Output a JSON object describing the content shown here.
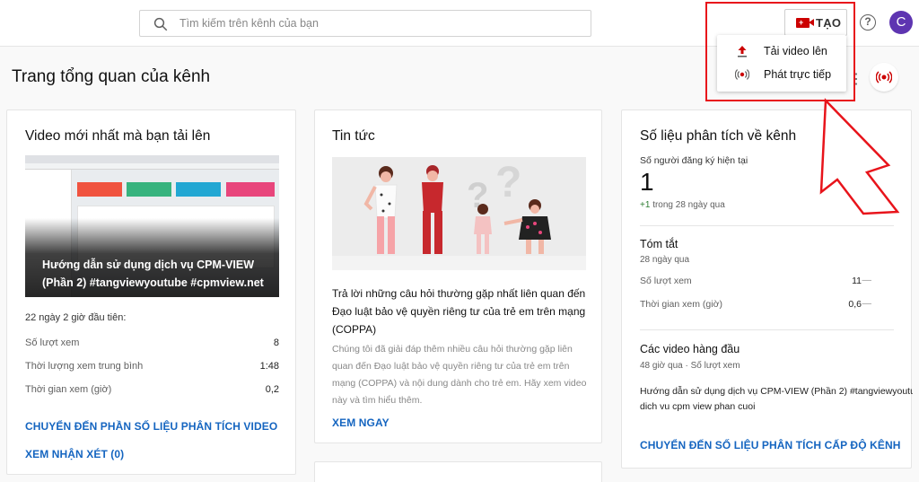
{
  "search": {
    "placeholder": "Tìm kiếm trên kênh của bạn"
  },
  "header": {
    "create_label": "TẠO",
    "help_icon": "help-icon",
    "avatar_letter": "C"
  },
  "create_menu": {
    "items": [
      {
        "label": "Tải video lên",
        "icon": "upload-icon"
      },
      {
        "label": "Phát trực tiếp",
        "icon": "live-icon"
      }
    ]
  },
  "page": {
    "title": "Trang tổng quan của kênh"
  },
  "latest_video": {
    "heading": "Video mới nhất mà bạn tải lên",
    "video_title": "Hướng dẫn sử dụng dịch vụ CPM-VIEW (Phần 2) #tangviewyoutube #cpmview.net",
    "period": "22 ngày 2 giờ đầu tiên:",
    "stats": [
      {
        "label": "Số lượt xem",
        "value": "8"
      },
      {
        "label": "Thời lượng xem trung bình",
        "value": "1:48"
      },
      {
        "label": "Thời gian xem (giờ)",
        "value": "0,2"
      }
    ],
    "analytics_link": "CHUYỂN ĐẾN PHẦN SỐ LIỆU PHÂN TÍCH VIDEO",
    "comments_link": "XEM NHẬN XÉT (0)"
  },
  "news": {
    "heading": "Tin tức",
    "title": "Trả lời những câu hỏi thường gặp nhất liên quan đến Đạo luật bảo vệ quyền riêng tư của trẻ em trên mạng (COPPA)",
    "body": "Chúng tôi đã giải đáp thêm nhiều câu hỏi thường gặp liên quan đến Đạo luật bảo vệ quyền riêng tư của trẻ em trên mạng (COPPA) và nội dung dành cho trẻ em. Hãy xem video này và tìm hiểu thêm.",
    "cta": "XEM NGAY"
  },
  "analytics": {
    "heading": "Số liệu phân tích về kênh",
    "subs_label": "Số người đăng ký hiện tại",
    "subs_value": "1",
    "subs_change": "+1",
    "subs_change_period": "trong 28 ngày qua",
    "summary_heading": "Tóm tắt",
    "summary_period": "28 ngày qua",
    "summary": [
      {
        "label": "Số lượt xem",
        "value": "11"
      },
      {
        "label": "Thời gian xem (giờ)",
        "value": "0,6"
      }
    ],
    "top_videos_heading": "Các video hàng đầu",
    "top_videos_meta": "48 giờ qua · Số lượt xem",
    "top_videos": [
      "Hướng dẫn sử dụng dịch vụ CPM-VIEW (Phần 2) #tangviewyoutube #cpmview.net",
      "dich vu cpm view phan cuoi"
    ],
    "channel_link": "CHUYỂN ĐẾN SỐ LIỆU PHÂN TÍCH CẤP ĐỘ KÊNH"
  },
  "colors": {
    "accent_link": "#1565c0",
    "annotation_red": "#e8141b",
    "brand_red": "#cc0000",
    "avatar": "#5e35b1",
    "positive": "#2e7d32"
  }
}
